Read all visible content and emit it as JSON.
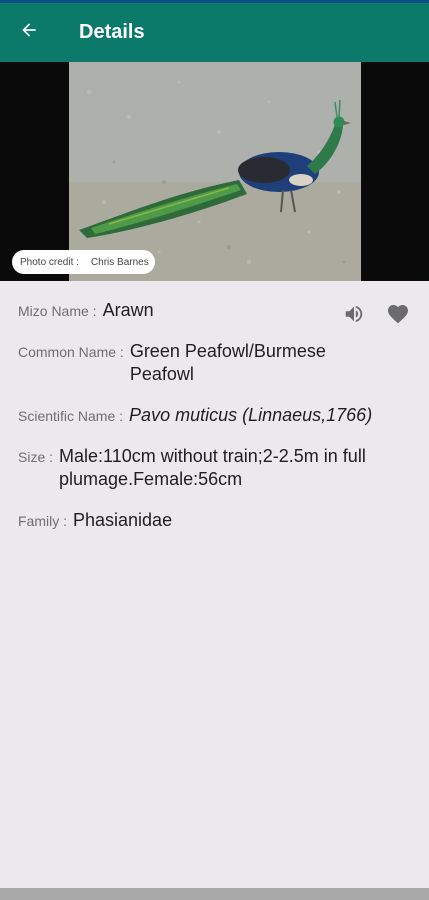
{
  "app_bar": {
    "title": "Details",
    "back_icon": "arrow-left-icon",
    "background": "#0b7a6a"
  },
  "photo": {
    "credit_label": "Photo credit :",
    "credit_name": "Chris Barnes"
  },
  "details": {
    "mizo_name_label": "Mizo Name :",
    "mizo_name": "Arawn",
    "common_name_label": "Common Name :",
    "common_name": "Green Peafowl/Burmese Peafowl",
    "scientific_name_label": "Scientific Name :",
    "scientific_name": "Pavo muticus (Linnaeus,1766)",
    "size_label": "Size :",
    "size": "Male:110cm without train;2-2.5m in full plumage.Female:56cm",
    "family_label": "Family :",
    "family": "Phasianidae"
  },
  "actions": {
    "sound_icon": "volume-icon",
    "favorite_icon": "heart-icon"
  }
}
